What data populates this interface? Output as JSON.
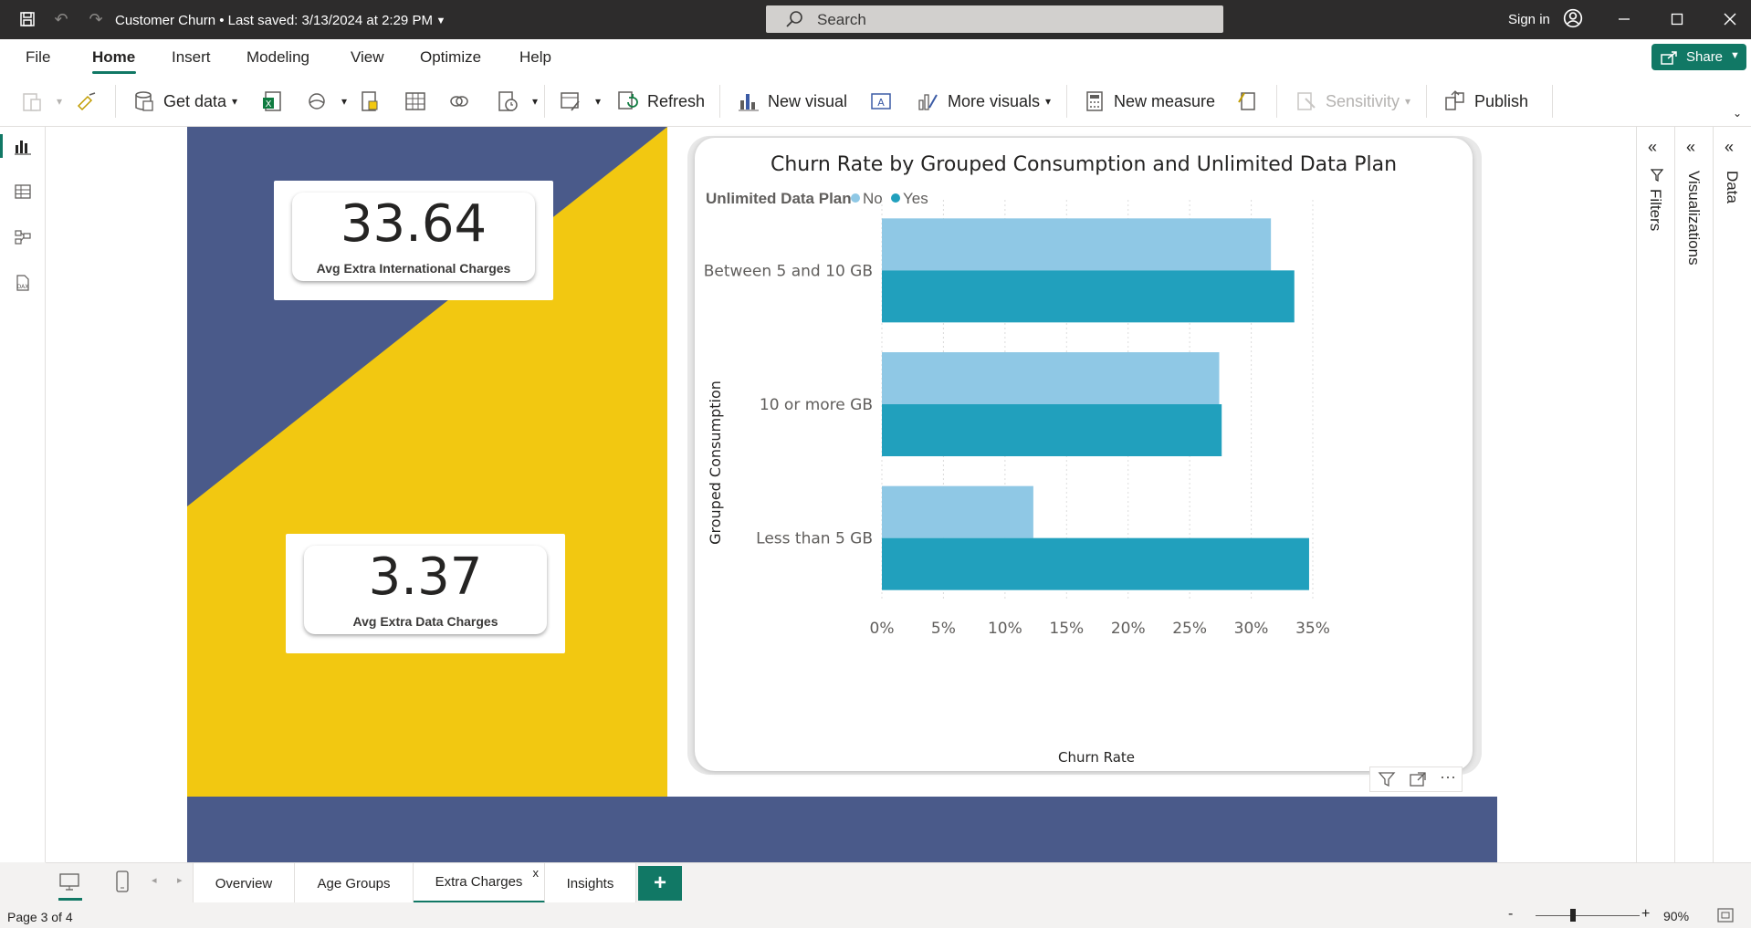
{
  "titlebar": {
    "doc_title": "Customer Churn • Last saved: 3/13/2024 at 2:29 PM",
    "search_placeholder": "Search",
    "signin_label": "Sign in"
  },
  "ribbon": {
    "tabs": [
      "File",
      "Home",
      "Insert",
      "Modeling",
      "View",
      "Optimize",
      "Help"
    ],
    "active_tab": "Home",
    "share_label": "Share"
  },
  "toolbar": {
    "get_data": "Get data",
    "refresh": "Refresh",
    "new_visual": "New visual",
    "more_visuals": "More visuals",
    "new_measure": "New measure",
    "sensitivity": "Sensitivity",
    "publish": "Publish"
  },
  "report": {
    "kpi1": {
      "value": "33.64",
      "label": "Avg Extra International Charges"
    },
    "kpi2": {
      "value": "3.37",
      "label": "Avg Extra Data Charges"
    },
    "colors": {
      "navy": "#4a5a8a",
      "yellow": "#f2c811",
      "no": "#8fc8e5",
      "yes": "#21a0bd"
    }
  },
  "chart_data": {
    "type": "bar",
    "orientation": "horizontal",
    "title": "Churn Rate by Grouped Consumption and Unlimited Data Plan",
    "legend_title": "Unlimited Data Plan",
    "legend_position": "top-left",
    "categories": [
      "Between 5 and 10 GB",
      "10 or more GB",
      "Less than 5 GB"
    ],
    "series": [
      {
        "name": "No",
        "color": "#8fc8e5",
        "values": [
          31.6,
          27.4,
          12.3
        ]
      },
      {
        "name": "Yes",
        "color": "#21a0bd",
        "values": [
          33.5,
          27.6,
          34.7
        ]
      }
    ],
    "xlabel": "Churn Rate",
    "ylabel": "Grouped Consumption",
    "xlim": [
      0,
      35
    ],
    "xticks": [
      "0%",
      "5%",
      "10%",
      "15%",
      "20%",
      "25%",
      "30%",
      "35%"
    ],
    "grid": true
  },
  "panes": {
    "filters": "Filters",
    "visualizations": "Visualizations",
    "data": "Data"
  },
  "pages": {
    "tabs": [
      "Overview",
      "Age Groups",
      "Extra Charges",
      "Insights"
    ],
    "active": "Extra Charges",
    "close_glyph": "x",
    "add_glyph": "+"
  },
  "status": {
    "page_indicator": "Page 3 of 4",
    "zoom": "90%"
  }
}
